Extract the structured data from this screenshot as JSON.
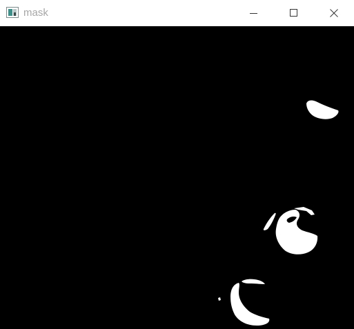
{
  "window": {
    "title": "mask",
    "controls": {
      "minimize": "minimize-icon",
      "maximize": "maximize-icon",
      "close": "close-icon"
    }
  },
  "image": {
    "background": "#000000",
    "foreground": "#ffffff"
  }
}
